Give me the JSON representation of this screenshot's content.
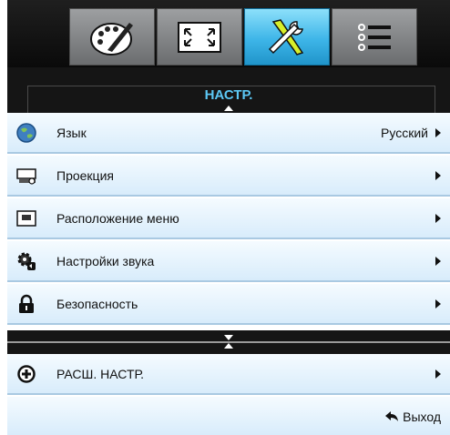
{
  "tabs": [
    {
      "icon": "palette-icon",
      "active": false
    },
    {
      "icon": "screen-resize-icon",
      "active": false
    },
    {
      "icon": "tools-icon",
      "active": true
    },
    {
      "icon": "list-icon",
      "active": false
    }
  ],
  "header": {
    "title": "НАСТР."
  },
  "menu": [
    {
      "label": "Язык",
      "value": "Русский",
      "icon": "globe-icon"
    },
    {
      "label": "Проекция",
      "value": "",
      "icon": "projector-icon"
    },
    {
      "label": "Расположение меню",
      "value": "",
      "icon": "menu-location-icon"
    },
    {
      "label": "Настройки звука",
      "value": "",
      "icon": "audio-settings-icon"
    },
    {
      "label": "Безопасность",
      "value": "",
      "icon": "lock-icon"
    }
  ],
  "advanced": {
    "label": "РАСШ. НАСТР.",
    "icon": "plus-circle-icon"
  },
  "footer": {
    "exit_label": "Выход",
    "icon": "return-arrow-icon"
  },
  "colors": {
    "accent": "#5cc8f5",
    "active_tab": "#3db5e8",
    "row_bg": "#e6f3fc"
  }
}
